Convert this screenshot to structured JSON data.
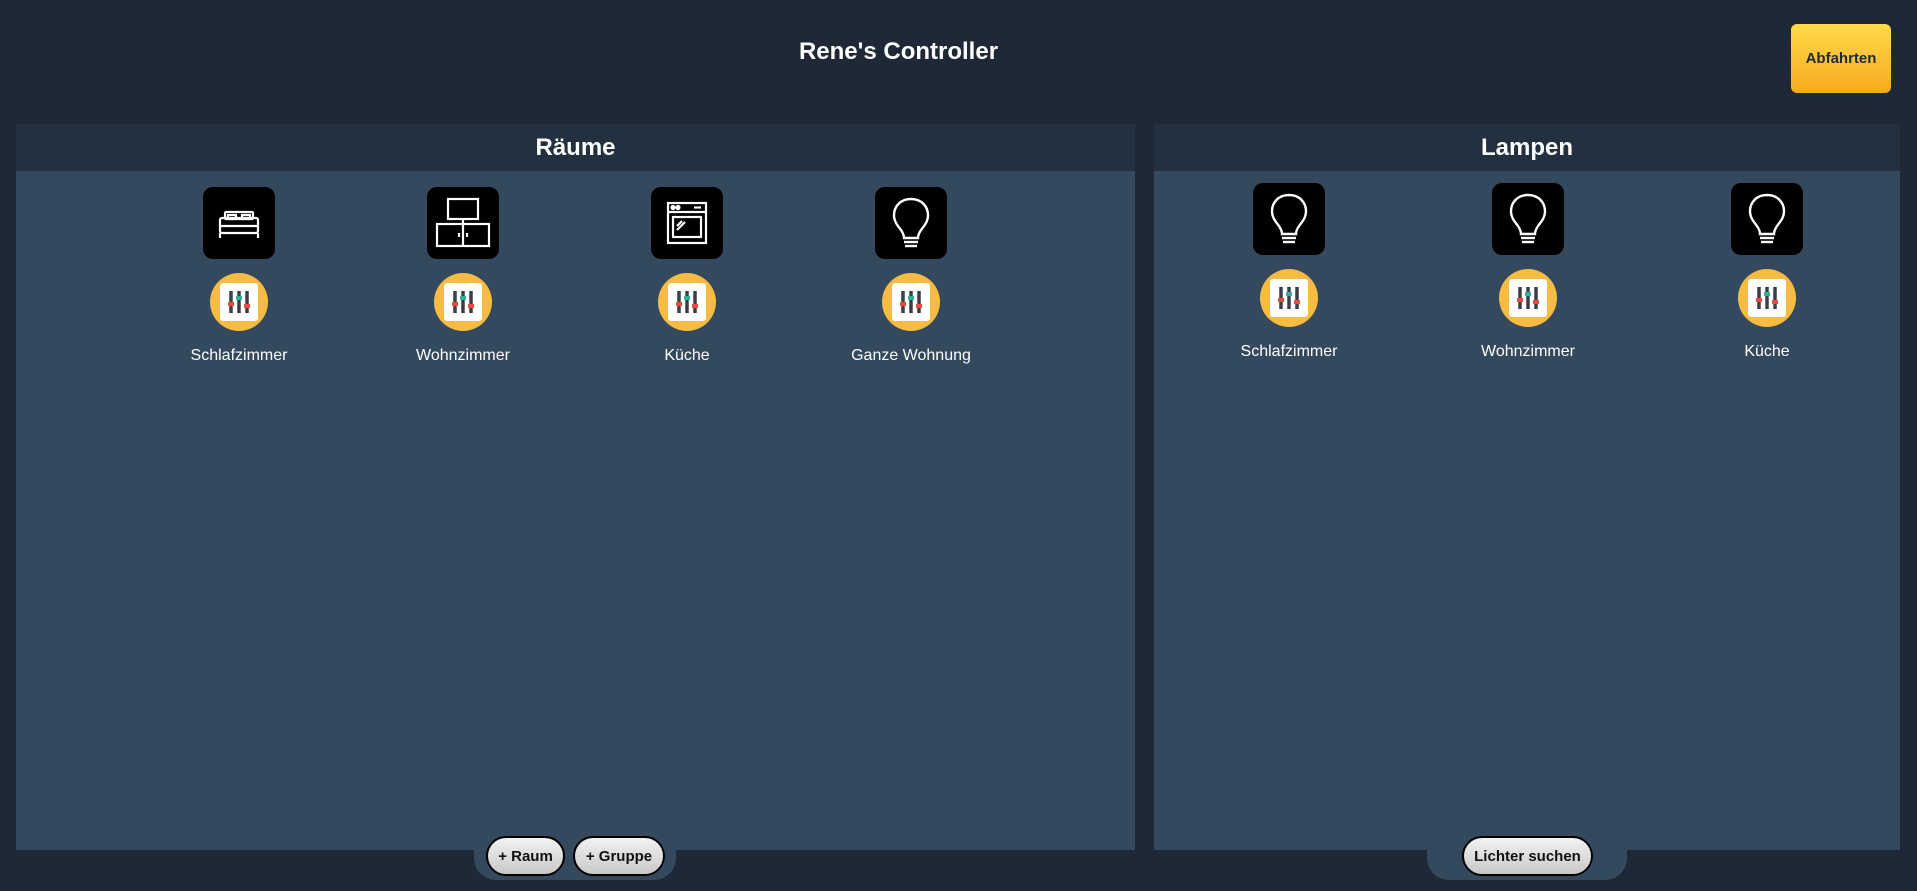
{
  "header": {
    "title": "Rene's Controller",
    "depart_label": "Abfahrten"
  },
  "rooms_panel": {
    "title": "Räume",
    "items": [
      {
        "label": "Schlafzimmer",
        "icon": "bed-icon"
      },
      {
        "label": "Wohnzimmer",
        "icon": "tv-furniture-icon"
      },
      {
        "label": "Küche",
        "icon": "oven-icon"
      },
      {
        "label": "Ganze Wohnung",
        "icon": "lightbulb-icon"
      }
    ],
    "add_room_label": "+ Raum",
    "add_group_label": "+ Gruppe"
  },
  "lamps_panel": {
    "title": "Lampen",
    "items": [
      {
        "label": "Schlafzimmer",
        "icon": "lightbulb-icon"
      },
      {
        "label": "Wohnzimmer",
        "icon": "lightbulb-icon"
      },
      {
        "label": "Küche",
        "icon": "lightbulb-icon"
      }
    ],
    "search_label": "Lichter suchen"
  },
  "colors": {
    "background": "#1e2836",
    "panel": "#34495e",
    "panel_header": "#22303f",
    "accent": "#f6bb40"
  }
}
